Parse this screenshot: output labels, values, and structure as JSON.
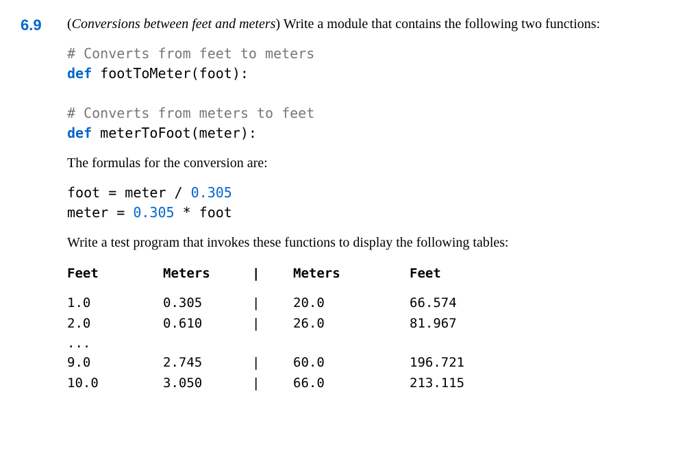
{
  "exercise": {
    "number": "6.9",
    "title": "Conversions between feet and meters",
    "intro_suffix": ") Write a module that contains the following two functions:",
    "code1_comment": "# Converts from feet to meters",
    "code1_keyword": "def",
    "code1_func": " footToMeter(foot):",
    "code2_comment": "# Converts from meters to feet",
    "code2_keyword": "def",
    "code2_func": " meterToFoot(meter):",
    "formula_intro": "The formulas for the conversion are:",
    "formula1_lhs": "foot = meter / ",
    "formula1_num": "0.305",
    "formula2_lhs": "meter = ",
    "formula2_num": "0.305",
    "formula2_rhs": " * foot",
    "test_instruction": "Write a test program that invokes these functions to display the following tables:",
    "table": {
      "headers": {
        "feet": "Feet",
        "meters": "Meters",
        "sep": "|",
        "meters2": "Meters",
        "feet2": "Feet"
      },
      "rows": [
        {
          "feet": "1.0",
          "meters": "0.305",
          "sep": "|",
          "meters2": "20.0",
          "feet2": "66.574"
        },
        {
          "feet": "2.0",
          "meters": "0.610",
          "sep": "|",
          "meters2": "26.0",
          "feet2": "81.967"
        }
      ],
      "ellipsis": "...",
      "rows_end": [
        {
          "feet": "9.0",
          "meters": "2.745",
          "sep": "|",
          "meters2": "60.0",
          "feet2": "196.721"
        },
        {
          "feet": "10.0",
          "meters": "3.050",
          "sep": "|",
          "meters2": "66.0",
          "feet2": "213.115"
        }
      ]
    }
  }
}
